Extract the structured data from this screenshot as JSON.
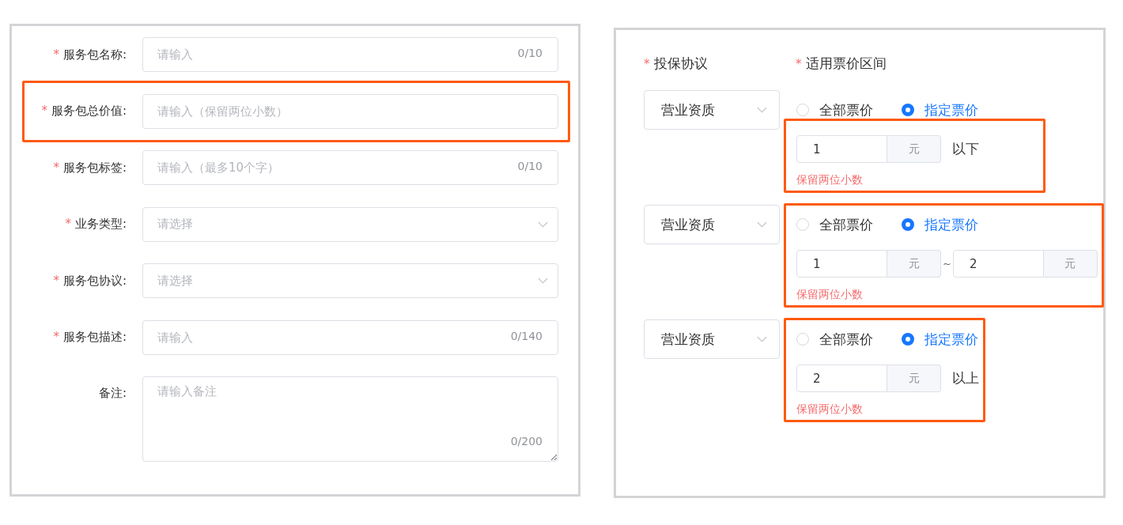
{
  "service_form": {
    "fields": [
      {
        "required_mark": "*",
        "label": "服务包名称:",
        "kind": "input",
        "placeholder": "请输入",
        "counter": "0/10",
        "highlighted": false
      },
      {
        "required_mark": "*",
        "label": "服务包总价值:",
        "kind": "input",
        "placeholder": "请输入（保留两位小数）",
        "highlighted": true
      },
      {
        "required_mark": "*",
        "label": "服务包标签:",
        "kind": "input",
        "placeholder": "请输入（最多10个字）",
        "counter": "0/10",
        "highlighted": false
      },
      {
        "required_mark": "*",
        "label": "业务类型:",
        "kind": "select",
        "placeholder": "请选择",
        "highlighted": false
      },
      {
        "required_mark": "*",
        "label": "服务包协议:",
        "kind": "select",
        "placeholder": "请选择",
        "highlighted": false
      },
      {
        "required_mark": "*",
        "label": "服务包描述:",
        "kind": "input",
        "placeholder": "请输入",
        "counter": "0/140",
        "highlighted": false
      },
      {
        "label": "备注:",
        "kind": "textarea",
        "placeholder": "请输入备注",
        "counter": "0/200",
        "highlighted": false
      }
    ]
  },
  "price_form": {
    "headers": [
      {
        "required_mark": "*",
        "label": "投保协议"
      },
      {
        "required_mark": "*",
        "label": "适用票价区间"
      }
    ],
    "rows": [
      {
        "agreement": "营业资质",
        "options": [
          {
            "label": "全部票价",
            "selected": false
          },
          {
            "label": "指定票价",
            "selected": true
          }
        ],
        "prices": [
          {
            "value": "1",
            "unit": "元"
          }
        ],
        "suffix": "以下",
        "hint": "保留两位小数",
        "options_highlighted": false,
        "values_highlighted": true
      },
      {
        "agreement": "营业资质",
        "options": [
          {
            "label": "全部票价",
            "selected": false
          },
          {
            "label": "指定票价",
            "selected": true
          }
        ],
        "prices": [
          {
            "value": "1",
            "unit": "元"
          },
          {
            "value": "2",
            "unit": "元"
          }
        ],
        "separator": "~",
        "hint": "保留两位小数",
        "options_highlighted": true,
        "values_highlighted": true
      },
      {
        "agreement": "营业资质",
        "options": [
          {
            "label": "全部票价",
            "selected": false
          },
          {
            "label": "指定票价",
            "selected": true
          }
        ],
        "prices": [
          {
            "value": "2",
            "unit": "元"
          }
        ],
        "suffix": "以上",
        "hint": "保留两位小数",
        "options_highlighted": true,
        "values_highlighted": true
      }
    ]
  }
}
